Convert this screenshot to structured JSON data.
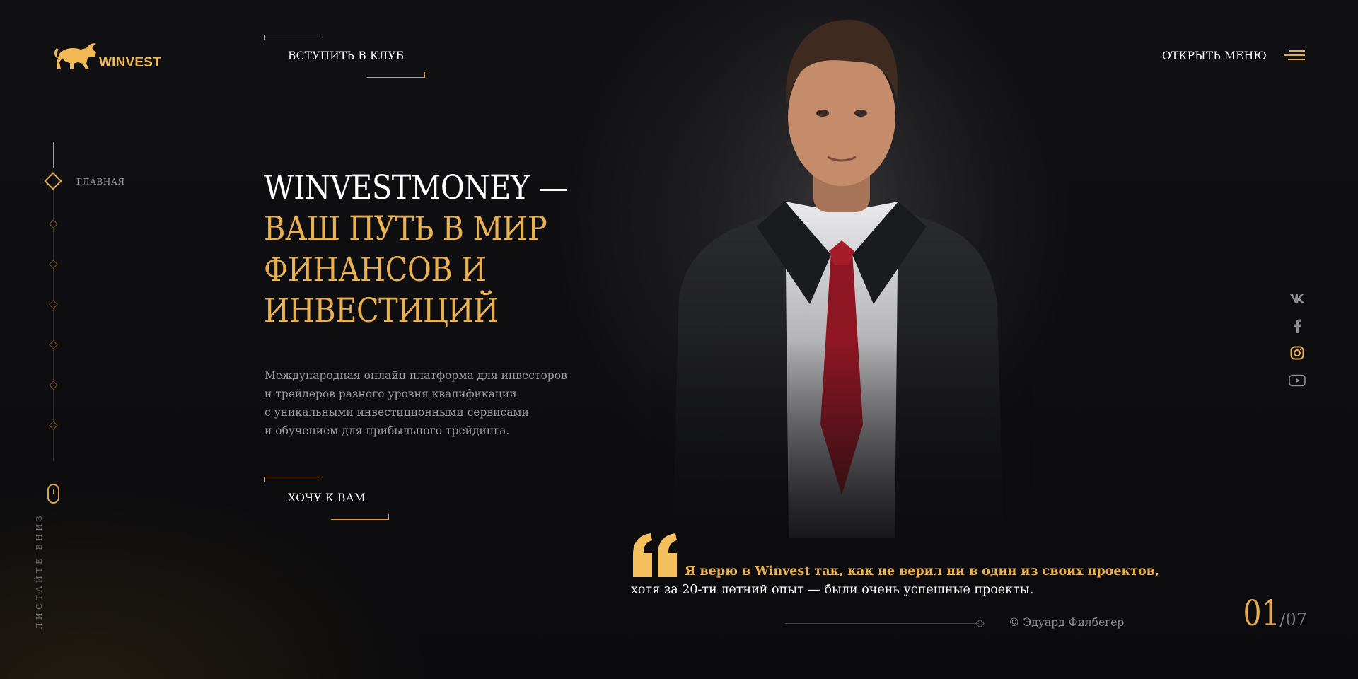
{
  "brand": {
    "name": "WINVEST",
    "color": "#f2b955"
  },
  "header": {
    "join_label": "ВСТУПИТЬ В КЛУБ",
    "menu_label": "ОТКРЫТЬ МЕНЮ"
  },
  "nav": {
    "items": [
      {
        "label": "ГЛАВНАЯ",
        "active": true
      },
      {
        "label": "",
        "active": false
      },
      {
        "label": "",
        "active": false
      },
      {
        "label": "",
        "active": false
      },
      {
        "label": "",
        "active": false
      },
      {
        "label": "",
        "active": false
      },
      {
        "label": "",
        "active": false
      }
    ],
    "scroll_label": "ЛИСТАЙТЕ ВНИЗ"
  },
  "hero": {
    "title_white": "WINVESTMONEY —",
    "title_gold": [
      "ВАШ ПУТЬ В МИР",
      "ФИНАНСОВ И",
      "ИНВЕСТИЦИЙ"
    ],
    "description": [
      "Международная онлайн платформа для инвесторов",
      "и трейдеров разного уровня квалификации",
      "с уникальными инвестиционными сервисами",
      "и обучением для прибыльного трейдинга."
    ],
    "cta_label": "ХОЧУ К ВАМ"
  },
  "social": [
    "vk-icon",
    "facebook-icon",
    "instagram-icon",
    "youtube-icon"
  ],
  "quote": {
    "line1": "Я верю в Winvest так, как не верил ни в один из своих проектов,",
    "line2": "хотя  за 20-ти летний опыт — были  очень успешные проекты.",
    "author": "© Эдуард Филбегер"
  },
  "counter": {
    "current": "01",
    "separator": "/",
    "total": "07"
  },
  "colors": {
    "accent": "#eab150",
    "background": "#0c0c0e"
  }
}
